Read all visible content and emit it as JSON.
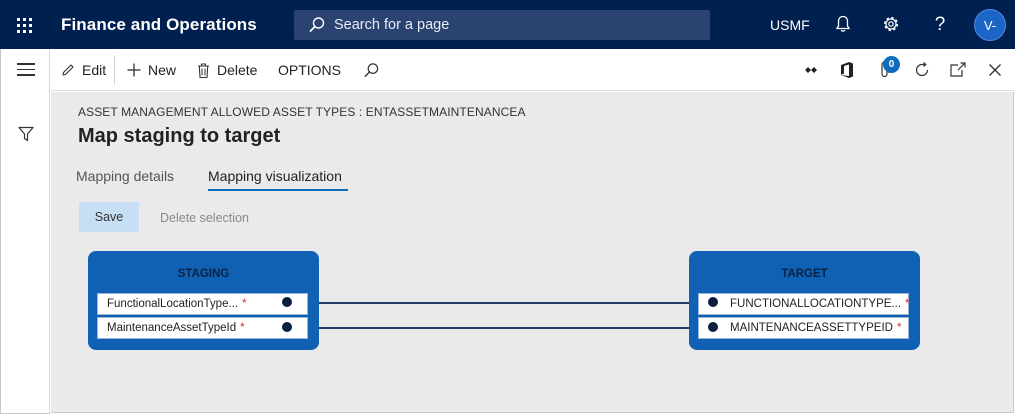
{
  "header": {
    "app_title": "Finance and Operations",
    "search_placeholder": "Search for a page",
    "company": "USMF",
    "help": "?",
    "avatar": "V-"
  },
  "actionbar": {
    "edit": "Edit",
    "new": "New",
    "delete": "Delete",
    "options": "OPTIONS",
    "attachments_count": "0"
  },
  "page": {
    "caption": "ASSET MANAGEMENT ALLOWED ASSET TYPES : ENTASSETMAINTENANCEA",
    "title": "Map staging to target",
    "tabs": [
      {
        "label": "Mapping details",
        "active": false
      },
      {
        "label": "Mapping visualization",
        "active": true
      }
    ],
    "save": "Save",
    "delete_selection": "Delete selection"
  },
  "mapping": {
    "staging": {
      "title": "STAGING",
      "fields": [
        {
          "name": "FunctionalLocationType...",
          "required": "*"
        },
        {
          "name": "MaintenanceAssetTypeId",
          "required": "*"
        }
      ]
    },
    "target": {
      "title": "TARGET",
      "fields": [
        {
          "name": "FUNCTIONALLOCATIONTYPE...",
          "required": "*"
        },
        {
          "name": "MAINTENANCEASSETTYPEID",
          "required": "*"
        }
      ]
    }
  },
  "colors": {
    "header": "#002050",
    "entity": "#1061b3",
    "accent": "#0f6cbd",
    "required": "#d13438"
  }
}
